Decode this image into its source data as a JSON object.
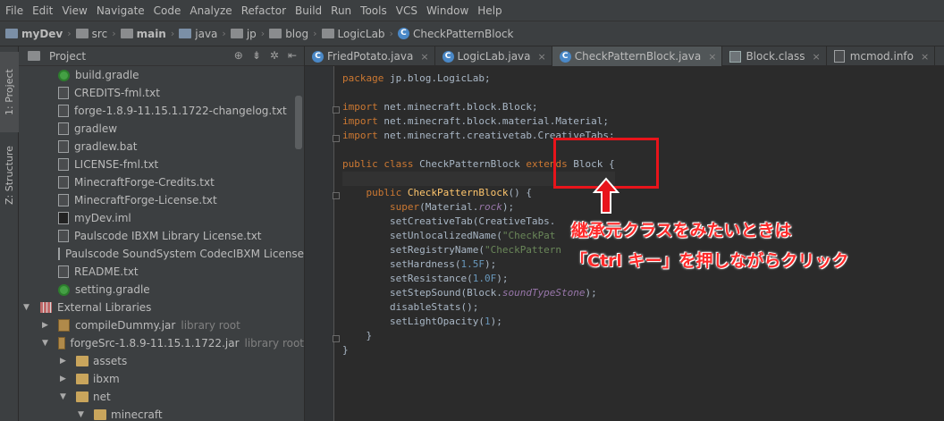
{
  "menu": [
    "File",
    "Edit",
    "View",
    "Navigate",
    "Code",
    "Analyze",
    "Refactor",
    "Build",
    "Run",
    "Tools",
    "VCS",
    "Window",
    "Help"
  ],
  "breadcrumb": [
    "myDev",
    "src",
    "main",
    "java",
    "jp",
    "blog",
    "LogicLab",
    "CheckPatternBlock"
  ],
  "sidebar_tabs": [
    "1: Project",
    "Z: Structure"
  ],
  "project_panel": {
    "title": "Project",
    "tools": [
      "⊕",
      "⇟",
      "✲",
      "⇤"
    ],
    "items": [
      {
        "label": "build.gradle",
        "suffix": ""
      },
      {
        "label": "CREDITS-fml.txt",
        "suffix": ""
      },
      {
        "label": "forge-1.8.9-11.15.1.1722-changelog.txt",
        "suffix": ""
      },
      {
        "label": "gradlew",
        "suffix": ""
      },
      {
        "label": "gradlew.bat",
        "suffix": ""
      },
      {
        "label": "LICENSE-fml.txt",
        "suffix": ""
      },
      {
        "label": "MinecraftForge-Credits.txt",
        "suffix": ""
      },
      {
        "label": "MinecraftForge-License.txt",
        "suffix": ""
      },
      {
        "label": "myDev.iml",
        "suffix": ""
      },
      {
        "label": "Paulscode IBXM Library License.txt",
        "suffix": ""
      },
      {
        "label": "Paulscode SoundSystem CodecIBXM License",
        "suffix": ""
      },
      {
        "label": "README.txt",
        "suffix": ""
      },
      {
        "label": "setting.gradle",
        "suffix": ""
      },
      {
        "label": "External Libraries",
        "suffix": ""
      },
      {
        "label": "compileDummy.jar",
        "suffix": "library root"
      },
      {
        "label": "forgeSrc-1.8.9-11.15.1.1722.jar",
        "suffix": "library root"
      },
      {
        "label": "assets",
        "suffix": ""
      },
      {
        "label": "ibxm",
        "suffix": ""
      },
      {
        "label": "net",
        "suffix": ""
      },
      {
        "label": "minecraft",
        "suffix": ""
      }
    ]
  },
  "tabs": [
    {
      "label": "FriedPotato.java",
      "close": "×"
    },
    {
      "label": "LogicLab.java",
      "close": "×"
    },
    {
      "label": "CheckPatternBlock.java",
      "close": "×"
    },
    {
      "label": "Block.class",
      "close": "×"
    },
    {
      "label": "mcmod.info",
      "close": "×"
    }
  ],
  "code": {
    "l1_kw": "package",
    "l1_rest": " jp.blog.LogicLab;",
    "l3_kw": "import",
    "l3_rest": " net.minecraft.block.Block;",
    "l4_kw": "import",
    "l4_rest": " net.minecraft.block.material.Material;",
    "l5_kw": "import",
    "l5_rest": " net.minecraft.creativetab.CreativeTabs;",
    "l7_kw1": "public class",
    "l7_name": " CheckPatternBlock ",
    "l7_kw2": "extends",
    "l7_rest": " Block {",
    "l9_kw": "public",
    "l9_fn": " CheckPatternBlock",
    "l9_rest": "() {",
    "l10_kw": "super",
    "l10_a": "(Material.",
    "l10_it": "rock",
    "l10_b": ");",
    "l11": "setCreativeTab(CreativeTabs.",
    "l12_a": "setUnlocalizedName(",
    "l12_st": "\"CheckPat",
    "l13_a": "setRegistryName(",
    "l13_st": "\"CheckPattern",
    "l14_a": "setHardness(",
    "l14_n": "1.5F",
    "l14_b": ");",
    "l15_a": "setResistance(",
    "l15_n": "1.0F",
    "l15_b": ");",
    "l16_a": "setStepSound(Block.",
    "l16_it": "soundTypeStone",
    "l16_b": ");",
    "l17": "disableStats();",
    "l18_a": "setLightOpacity(",
    "l18_n": "1",
    "l18_b": ");",
    "l19": "}",
    "l20": "}"
  },
  "annotation": {
    "line1": "継承元クラスをみたいときは",
    "line2": "「Ctrl キー」を押しながらクリック",
    "color": "#ff2a2a"
  }
}
